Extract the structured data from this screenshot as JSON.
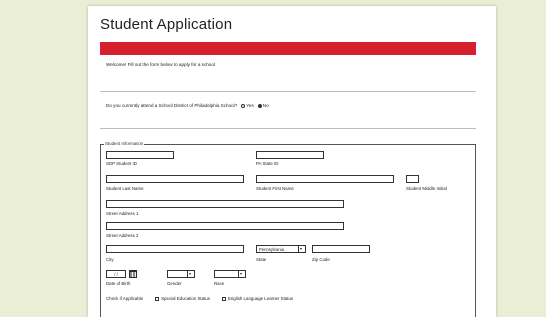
{
  "form": {
    "title": "Student Application",
    "welcome": "Welcome! Fill out the form below to apply for a school",
    "question": {
      "text": "Do you currently attend a School District of Philadelphia School?",
      "options": [
        "Yes",
        "No"
      ],
      "selected": "No"
    },
    "section_legend": "Student Information",
    "labels": {
      "sdp_id": "SDP Student ID",
      "pa_state_id": "PA State ID",
      "last_name": "Student Last Name",
      "first_name": "Student First Name",
      "middle_initial": "Student Middle Initial",
      "street1": "Street Address 1",
      "street2": "Street Address 2",
      "city": "City",
      "state": "State",
      "zip": "Zip Code",
      "dob": "Date of Birth",
      "gender": "Gender",
      "race": "Race"
    },
    "values": {
      "state": "Pennsylvania",
      "dob": "/ /",
      "gender": "",
      "race": ""
    },
    "checks": {
      "label": "Check if Applicable",
      "special_ed": "Special Education Status",
      "ell": "English Language Learner Status"
    }
  },
  "colors": {
    "accent_bar": "#d6202e",
    "background": "#eaeed6"
  }
}
